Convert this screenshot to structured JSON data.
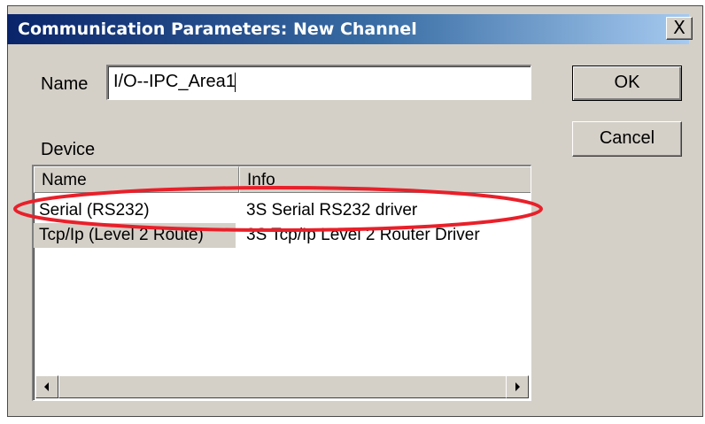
{
  "window": {
    "title": "Communication Parameters: New Channel",
    "close_label": "X"
  },
  "name_field": {
    "label": "Name",
    "value": "I/O--IPC_Area1"
  },
  "buttons": {
    "ok": "OK",
    "cancel": "Cancel"
  },
  "device": {
    "label": "Device",
    "columns": [
      "Name",
      "Info"
    ],
    "rows": [
      {
        "name": "Serial (RS232)",
        "info": "3S Serial RS232 driver"
      },
      {
        "name": "Tcp/Ip (Level 2 Route)",
        "info": "3S Tcp/Ip Level 2 Router Driver"
      }
    ]
  },
  "annotation": {
    "color": "#e8202a"
  },
  "colors": {
    "titlebar_start": "#0a246a",
    "titlebar_end": "#a6caf0",
    "dialog_face": "#d4d0c8"
  },
  "icons": {
    "scroll_left": "triangle-left-icon",
    "scroll_right": "triangle-right-icon"
  }
}
